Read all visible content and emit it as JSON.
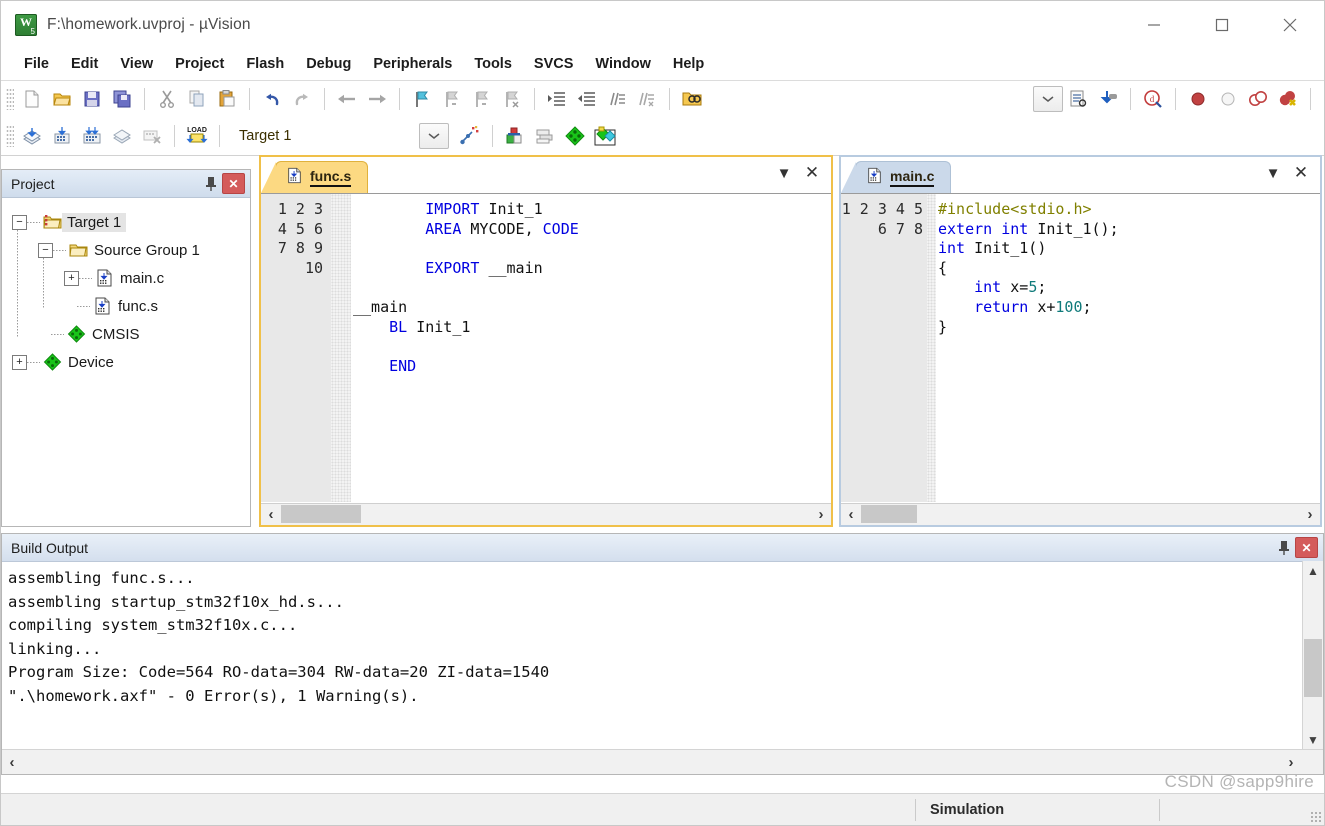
{
  "window": {
    "title": "F:\\homework.uvproj - µVision",
    "icon": "uvision-app-icon",
    "minimize_label": "minimize-icon",
    "maximize_label": "maximize-icon",
    "close_label": "close-icon"
  },
  "menu": {
    "items": [
      {
        "label": "File"
      },
      {
        "label": "Edit"
      },
      {
        "label": "View"
      },
      {
        "label": "Project"
      },
      {
        "label": "Flash"
      },
      {
        "label": "Debug"
      },
      {
        "label": "Peripherals"
      },
      {
        "label": "Tools"
      },
      {
        "label": "SVCS"
      },
      {
        "label": "Window"
      },
      {
        "label": "Help"
      }
    ]
  },
  "toolbar_main": {
    "icons": [
      "new-file-icon",
      "open-file-icon",
      "save-icon",
      "save-all-icon",
      "cut-icon",
      "copy-icon",
      "paste-icon",
      "undo-icon",
      "redo-icon",
      "navigate-back-icon",
      "navigate-forward-icon",
      "bookmark-toggle-icon",
      "bookmark-prev-icon",
      "bookmark-next-icon",
      "bookmark-clear-icon",
      "indent-icon",
      "outdent-icon",
      "comment-icon",
      "uncomment-icon",
      "find-in-files-icon"
    ],
    "right_icons": [
      "combo-dropdown-icon",
      "debug-settings-icon",
      "download-icon",
      "start-debug-icon",
      "insert-breakpoint-icon",
      "disable-breakpoint-icon",
      "kill-all-breakpoints-icon",
      "disable-all-breakpoints-icon"
    ]
  },
  "toolbar_build": {
    "icons": [
      "translate-file-icon",
      "build-target-icon",
      "rebuild-all-icon",
      "batch-build-icon",
      "stop-build-icon",
      "download-to-flash-icon"
    ],
    "target_value": "Target 1",
    "dropdown_icon": "chevron-down-icon",
    "right_icons": [
      "target-options-icon",
      "manage-project-items-icon",
      "manage-runtime-env-icon",
      "pack-installer-icon"
    ]
  },
  "project_panel": {
    "title": "Project",
    "pin_icon": "pin-icon",
    "close_icon": "close-icon",
    "tree": [
      {
        "label": "Target 1",
        "icon": "target-folder-icon",
        "expander": "minus",
        "depth": 0,
        "selected": true
      },
      {
        "label": "Source Group 1",
        "icon": "folder-icon",
        "expander": "minus",
        "depth": 1,
        "selected": false
      },
      {
        "label": "main.c",
        "icon": "c-file-icon",
        "expander": "plus",
        "depth": 2,
        "selected": false
      },
      {
        "label": "func.s",
        "icon": "asm-file-icon",
        "expander": "none",
        "depth": 2,
        "selected": false
      },
      {
        "label": "CMSIS",
        "icon": "component-icon",
        "expander": "none",
        "depth": 1,
        "selected": false
      },
      {
        "label": "Device",
        "icon": "component-icon",
        "expander": "plus",
        "depth": 1,
        "selected": false
      }
    ]
  },
  "editor_left": {
    "tab_label": "func.s",
    "tab_icon": "asm-file-icon",
    "dropdown_icon": "chevron-down-icon",
    "close_icon": "close-icon",
    "active": true,
    "line_numbers": "1\n2\n3\n4\n5\n6\n7\n8\n9\n10",
    "code_lines": [
      "        IMPORT Init_1",
      "        AREA MYCODE, CODE",
      "",
      "        EXPORT __main",
      "",
      "__main",
      "    BL Init_1",
      "",
      "    END",
      ""
    ]
  },
  "editor_right": {
    "tab_label": "main.c",
    "tab_icon": "c-file-icon",
    "dropdown_icon": "chevron-down-icon",
    "close_icon": "close-icon",
    "active": false,
    "line_numbers": "1\n2\n3\n4\n5\n6\n7\n8",
    "code_lines": [
      "#include<stdio.h>",
      "extern int Init_1();",
      "int Init_1()",
      "{",
      "    int x=5;",
      "    return x+100;",
      ""
    ]
  },
  "build_output": {
    "title": "Build Output",
    "pin_icon": "pin-icon",
    "close_icon": "close-icon",
    "lines": [
      "assembling func.s...",
      "assembling startup_stm32f10x_hd.s...",
      "compiling system_stm32f10x.c...",
      "linking...",
      "Program Size: Code=564 RO-data=304 RW-data=20 ZI-data=1540",
      "\".\\homework.axf\" - 0 Error(s), 1 Warning(s)."
    ]
  },
  "status_bar": {
    "simulation": "Simulation",
    "watermark": "CSDN @sapp9hire"
  },
  "colors": {
    "active_tab": "#fcd982",
    "inactive_tab": "#cbd9ea",
    "panel_header": "#d4dfee",
    "keyword_blue": "#0000e0",
    "number_teal": "#0f7a7a",
    "include_olive": "#808000",
    "close_red": "#d45b5b"
  }
}
